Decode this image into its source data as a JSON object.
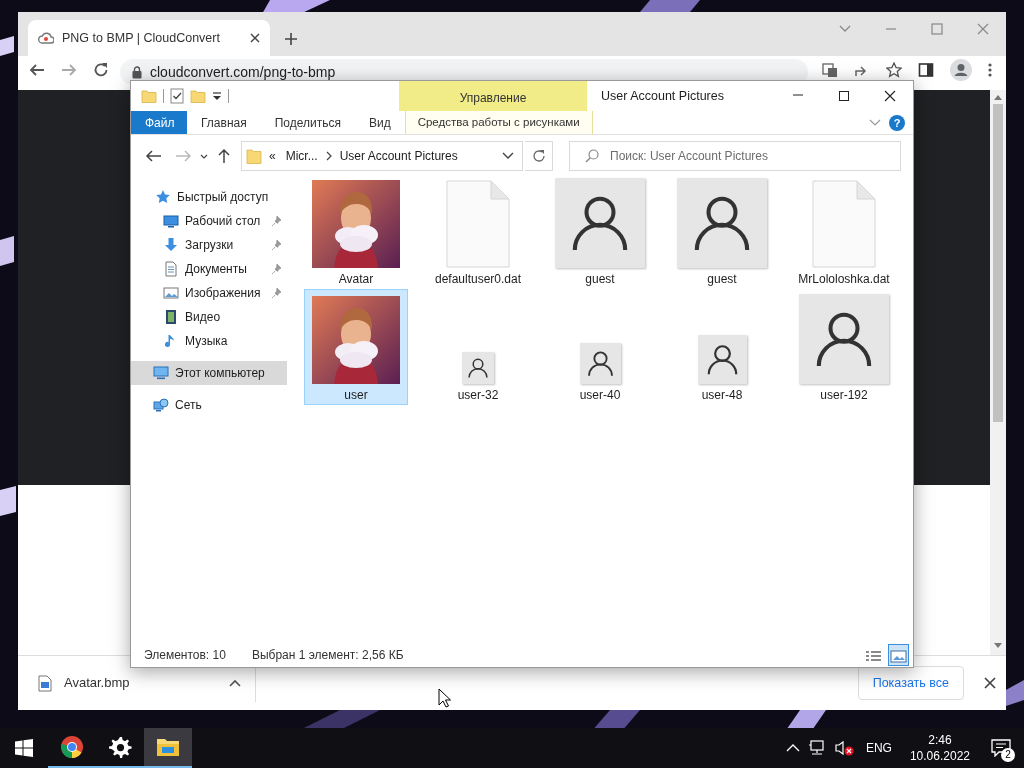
{
  "browser": {
    "tabs": [
      {
        "title": "PNG to BMP | CloudConvert",
        "selected": true
      }
    ],
    "address": "cloudconvert.com/png-to-bmp",
    "downloads": [
      {
        "file": "Avatar.bmp"
      }
    ],
    "show_all_button": "Показать все"
  },
  "explorer": {
    "title": "User Account Pictures",
    "context_group": "Управление",
    "ribbon_tabs": [
      {
        "label": "Файл",
        "kind": "file"
      },
      {
        "label": "Главная",
        "kind": "tab"
      },
      {
        "label": "Поделиться",
        "kind": "tab"
      },
      {
        "label": "Вид",
        "kind": "tab"
      },
      {
        "label": "Средства работы с рисунками",
        "kind": "context"
      }
    ],
    "help": "?",
    "overflow": "«",
    "breadcrumbs": [
      "Micr...",
      "User Account Pictures"
    ],
    "search": {
      "placeholder": "Поиск: User Account Pictures"
    },
    "nav": [
      {
        "label": "Быстрый доступ",
        "kind": "star",
        "selected": false,
        "children": [
          {
            "label": "Рабочий стол",
            "kind": "desktop",
            "pinned": true,
            "selected": false
          },
          {
            "label": "Загрузки",
            "kind": "download",
            "pinned": true,
            "selected": false
          },
          {
            "label": "Документы",
            "kind": "document",
            "pinned": true,
            "selected": false
          },
          {
            "label": "Изображения",
            "kind": "images",
            "pinned": true,
            "selected": false
          },
          {
            "label": "Видео",
            "kind": "video",
            "pinned": false,
            "selected": false
          },
          {
            "label": "Музыка",
            "kind": "music",
            "pinned": false,
            "selected": false
          }
        ]
      },
      {
        "label": "Этот компьютер",
        "kind": "computer",
        "selected": true
      },
      {
        "label": "Сеть",
        "kind": "network",
        "selected": false
      }
    ],
    "items": [
      {
        "name": "Avatar",
        "selected": false
      },
      {
        "name": "defaultuser0.dat",
        "kind": "file",
        "selected": false
      },
      {
        "name": "guest",
        "kind": "avatar",
        "selected": false
      },
      {
        "name": "guest",
        "kind": "avatar",
        "selected": false
      },
      {
        "name": "MrLololoshka.dat",
        "kind": "file",
        "selected": false
      },
      {
        "name": "user",
        "selected": true
      },
      {
        "name": "user-32",
        "kind": "avatar-xs",
        "selected": false
      },
      {
        "name": "user-40",
        "kind": "avatar-s",
        "selected": false
      },
      {
        "name": "user-48",
        "kind": "avatar-m",
        "selected": false
      },
      {
        "name": "user-192",
        "kind": "avatar",
        "selected": false
      }
    ],
    "status": {
      "count": "Элементов: 10",
      "selection": "Выбран 1 элемент: 2,56 КБ"
    },
    "views": [
      {
        "kind": "details",
        "selected": false
      },
      {
        "kind": "large-icons",
        "selected": true
      }
    ]
  },
  "taskbar": {
    "apps": [
      {
        "kind": "chrome",
        "running": true,
        "active": false
      },
      {
        "kind": "settings",
        "running": true,
        "active": false
      },
      {
        "kind": "explorer",
        "running": true,
        "active": true
      }
    ],
    "volume_muted": true,
    "language": "ENG",
    "time": "2:46",
    "date": "10.06.2022",
    "notifications": "2"
  }
}
